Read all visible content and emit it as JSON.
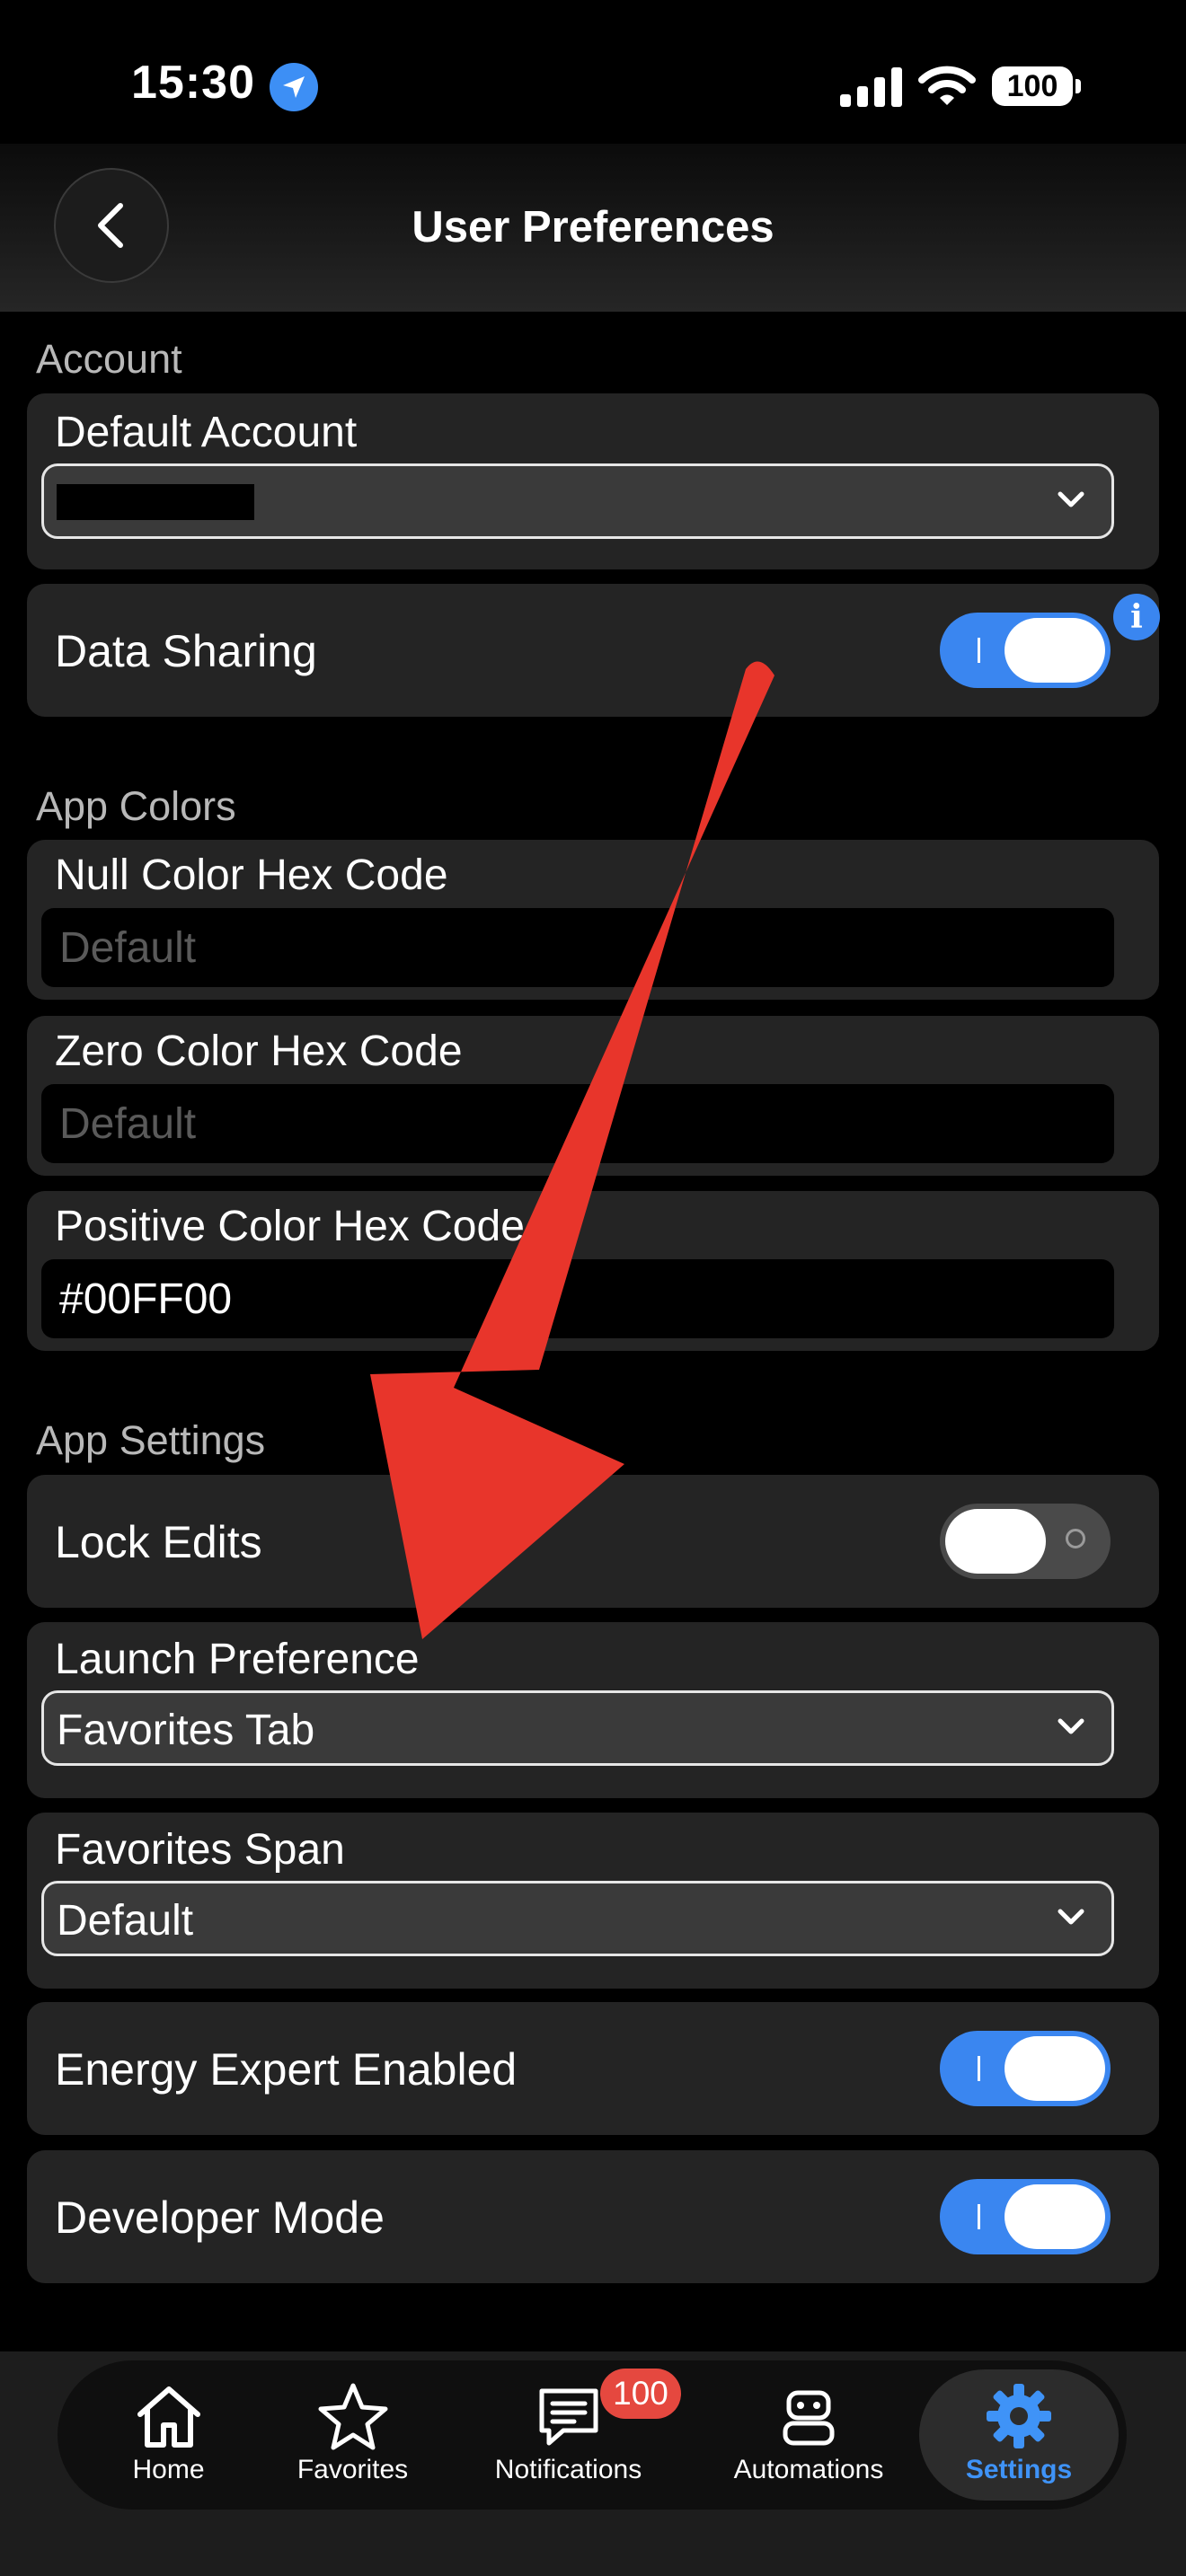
{
  "status_bar": {
    "time": "15:30",
    "battery": "100",
    "icons": [
      "location-icon",
      "signal-icon",
      "wifi-icon",
      "battery-icon"
    ]
  },
  "nav": {
    "title": "User Preferences",
    "back_icon": "chevron-left-icon"
  },
  "sections": {
    "account": "Account",
    "app_colors": "App Colors",
    "app_settings": "App Settings"
  },
  "account": {
    "default_account_label": "Default Account",
    "data_sharing_label": "Data Sharing",
    "data_sharing_on": true
  },
  "colors": {
    "null_label": "Null Color Hex Code",
    "null_placeholder": "Default",
    "zero_label": "Zero Color Hex Code",
    "zero_placeholder": "Default",
    "positive_label": "Positive Color Hex Code",
    "positive_value": "#00FF00"
  },
  "settings": {
    "lock_edits_label": "Lock Edits",
    "lock_edits_on": false,
    "launch_label": "Launch Preference",
    "launch_value": "Favorites Tab",
    "span_label": "Favorites Span",
    "span_value": "Default",
    "energy_label": "Energy Expert Enabled",
    "energy_on": true,
    "developer_label": "Developer Mode",
    "developer_on": true
  },
  "tabs": [
    {
      "label": "Home",
      "icon": "home-icon"
    },
    {
      "label": "Favorites",
      "icon": "star-icon"
    },
    {
      "label": "Notifications",
      "icon": "chat-bubble-icon",
      "badge": "100"
    },
    {
      "label": "Automations",
      "icon": "robot-icon"
    },
    {
      "label": "Settings",
      "icon": "gear-icon",
      "active": true
    }
  ],
  "colors_theme": {
    "accent": "#3a86f0",
    "arrow": "#e8352b",
    "badge": "#e5483f",
    "card": "#242424"
  }
}
